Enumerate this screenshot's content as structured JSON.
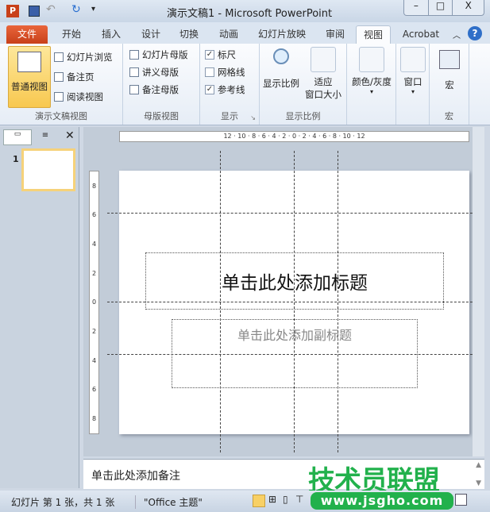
{
  "window": {
    "title": "演示文稿1 - Microsoft PowerPoint",
    "app_icon": "P"
  },
  "tabs": [
    {
      "label": "文件"
    },
    {
      "label": "开始"
    },
    {
      "label": "插入"
    },
    {
      "label": "设计"
    },
    {
      "label": "切换"
    },
    {
      "label": "动画"
    },
    {
      "label": "幻灯片放映"
    },
    {
      "label": "审阅"
    },
    {
      "label": "视图"
    },
    {
      "label": "Acrobat"
    }
  ],
  "ribbon": {
    "presentation_views": {
      "label": "演示文稿视图",
      "normal": "普通视图",
      "sorter": "幻灯片浏览",
      "notes_page": "备注页",
      "reading": "阅读视图"
    },
    "master_views": {
      "label": "母版视图",
      "slide_master": "幻灯片母版",
      "handout_master": "讲义母版",
      "notes_master": "备注母版"
    },
    "show": {
      "label": "显示",
      "ruler": "标尺",
      "ruler_checked": true,
      "gridlines": "网格线",
      "gridlines_checked": false,
      "guides": "参考线",
      "guides_checked": true
    },
    "zoom": {
      "label": "显示比例",
      "zoom": "显示比例",
      "fit_1": "适应",
      "fit_2": "窗口大小"
    },
    "color": {
      "label": "颜色/灰度"
    },
    "window": {
      "label": "窗口"
    },
    "macros": {
      "label": "宏",
      "group": "宏"
    }
  },
  "ruler_text": "12 · 10 · 8 · 6 · 4 · 2 · 0 · 2 · 4 · 6 · 8 · 10 · 12",
  "vruler": [
    "8",
    "6",
    "4",
    "2",
    "0",
    "2",
    "4",
    "6",
    "8"
  ],
  "slide": {
    "number": "1",
    "title_placeholder": "单击此处添加标题",
    "subtitle_placeholder": "单击此处添加副标题"
  },
  "notes": {
    "placeholder": "单击此处添加备注"
  },
  "status": {
    "slide_info": "幻灯片 第 1 张，共 1 张",
    "theme": "\"Office 主题\""
  },
  "watermark": {
    "text": "技术员联盟",
    "url": "www.jsgho.com"
  }
}
